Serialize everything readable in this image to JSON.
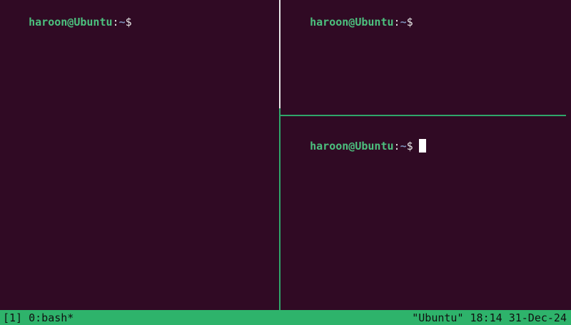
{
  "prompt": {
    "user_host": "haroon@Ubuntu",
    "separator": ":",
    "path": "~",
    "symbol": "$"
  },
  "status_bar": {
    "session": "[1]",
    "window": "0:bash*",
    "host": "\"Ubuntu\"",
    "time": "18:14",
    "date": "31-Dec-24"
  },
  "colors": {
    "background": "#300a24",
    "user_host": "#4cc07e",
    "path": "#7d8fb8",
    "active_border": "#2fa66a",
    "status_bar": "#2eb36b"
  }
}
